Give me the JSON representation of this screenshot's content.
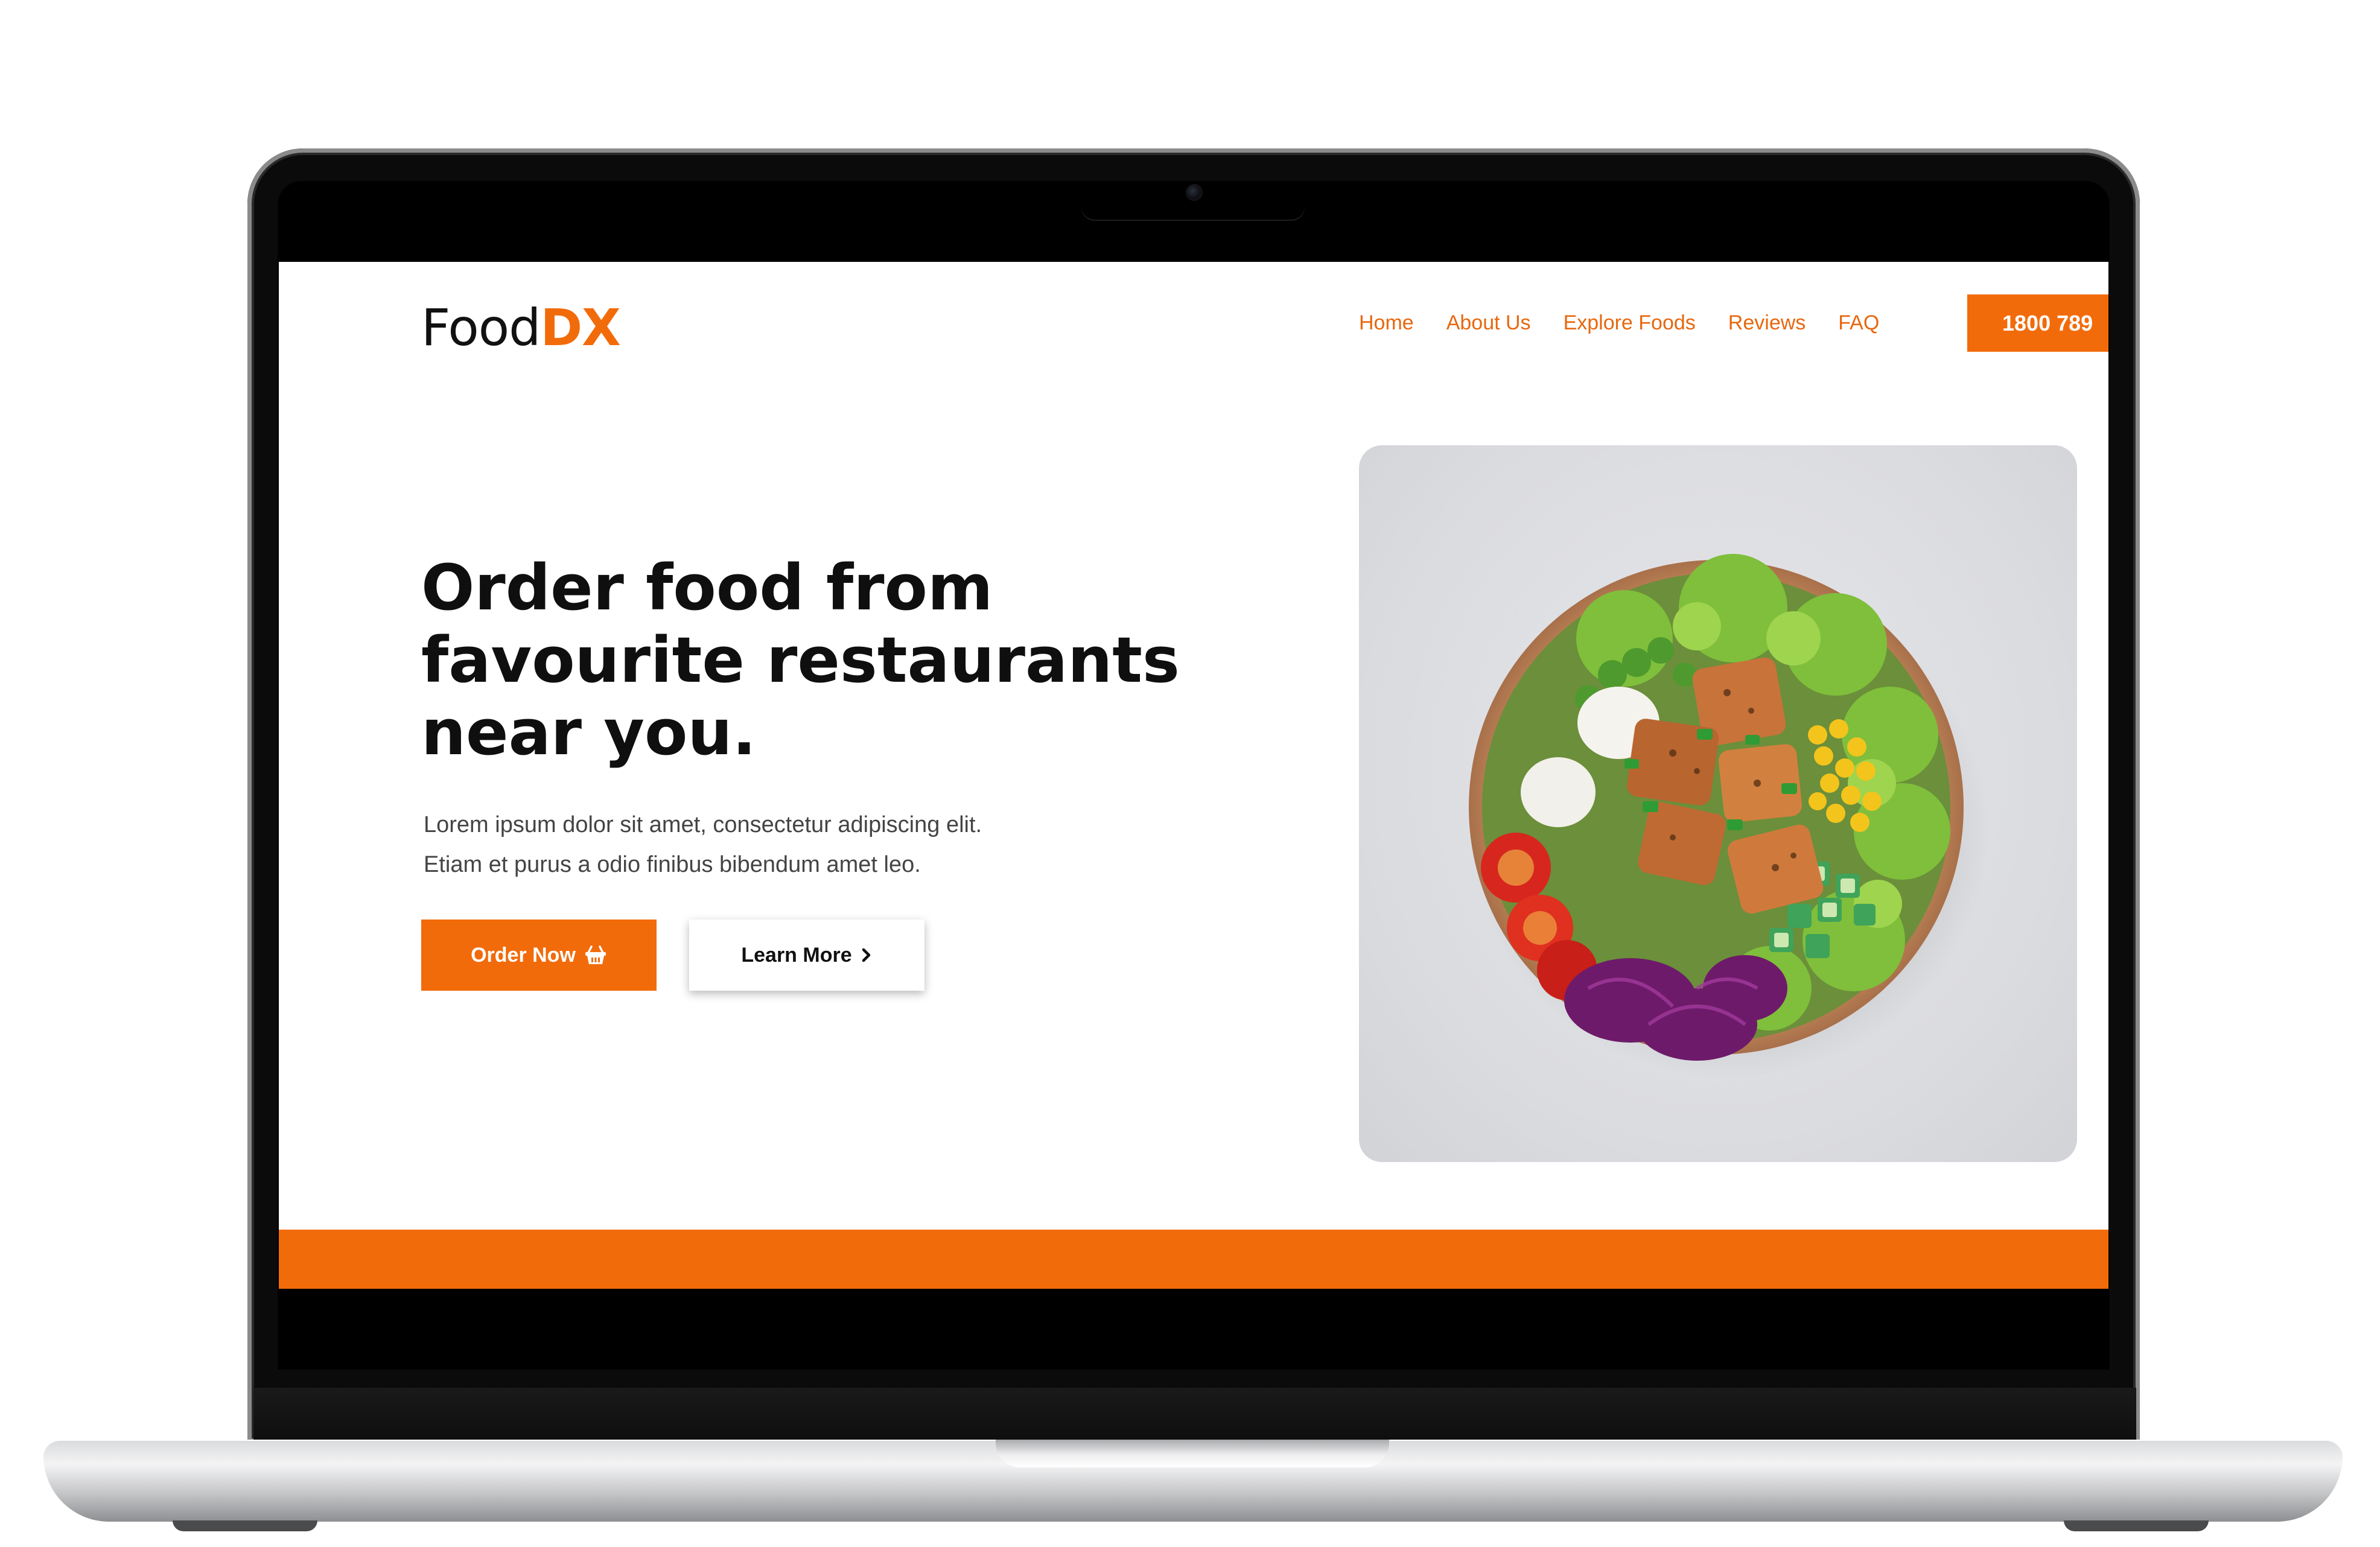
{
  "site": {
    "logo": {
      "part1": "Food",
      "part2": "DX"
    },
    "nav": [
      {
        "label": "Home"
      },
      {
        "label": "About Us"
      },
      {
        "label": "Explore Foods"
      },
      {
        "label": "Reviews"
      },
      {
        "label": "FAQ"
      }
    ],
    "phone_label": "1800 789",
    "hero": {
      "title_lines": [
        "Order food from",
        "favourite restaurants",
        "near you."
      ],
      "desc_lines": [
        "Lorem ipsum dolor sit amet, consectetur adipiscing elit.",
        "Etiam et purus a odio finibus bibendum amet leo."
      ],
      "order_button": "Order Now",
      "learn_button": "Learn More"
    }
  },
  "icons": {
    "order_button_icon": "shopping-basket-icon",
    "learn_button_icon": "chevron-right-icon",
    "hero_image": "salad-bowl-photo"
  },
  "colors": {
    "accent": "#f26b0a",
    "nav_text": "#e8670e",
    "text_dark": "#0f0f0f",
    "text_body": "#444444"
  }
}
